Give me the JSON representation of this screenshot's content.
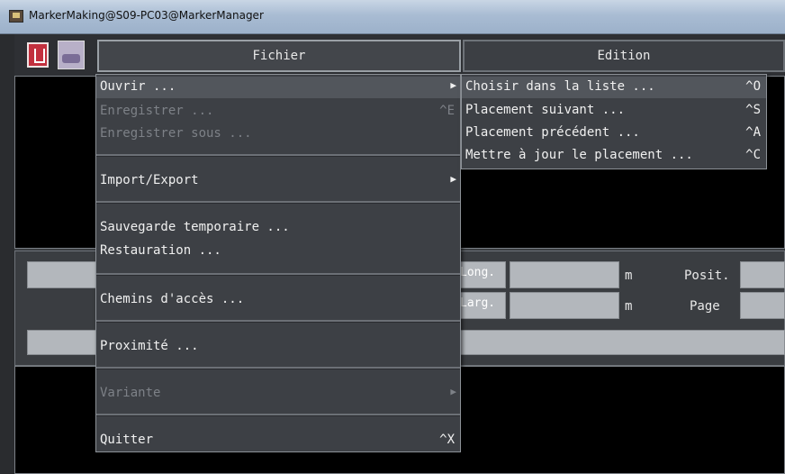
{
  "window": {
    "title": "MarkerMaking@S09-PC03@MarkerManager",
    "icon": "app-icon"
  },
  "toolbar": {
    "icons": [
      "red-document-icon",
      "sink-icon"
    ],
    "menus": [
      {
        "label": "Fichier"
      },
      {
        "label": "Edition"
      }
    ]
  },
  "fields": {
    "long_label": "Long.",
    "larg_label": "Larg.",
    "unit_1": "m",
    "unit_2": "m",
    "posit_label": "Posit.",
    "page_label": "Page"
  },
  "fichier_menu": {
    "items": [
      {
        "label": "Ouvrir ...",
        "shortcut": "",
        "submenu": true,
        "enabled": true,
        "highlighted": true
      },
      {
        "label": "Enregistrer ...",
        "shortcut": "^E",
        "submenu": false,
        "enabled": false
      },
      {
        "label": "Enregistrer sous ...",
        "shortcut": "",
        "submenu": false,
        "enabled": false
      },
      {
        "label": "Import/Export",
        "shortcut": "",
        "submenu": true,
        "enabled": true
      },
      {
        "label": "Sauvegarde temporaire ...",
        "shortcut": "",
        "submenu": false,
        "enabled": true
      },
      {
        "label": "Restauration ...",
        "shortcut": "",
        "submenu": false,
        "enabled": true
      },
      {
        "label": "Chemins d'accès ...",
        "shortcut": "",
        "submenu": false,
        "enabled": true
      },
      {
        "label": "Proximité ...",
        "shortcut": "",
        "submenu": false,
        "enabled": true
      },
      {
        "label": "Variante",
        "shortcut": "",
        "submenu": true,
        "enabled": false
      },
      {
        "label": "Quitter",
        "shortcut": "^X",
        "submenu": false,
        "enabled": true
      }
    ]
  },
  "ouvrir_submenu": {
    "items": [
      {
        "label": "Choisir dans la liste ...",
        "shortcut": "^O",
        "highlighted": true
      },
      {
        "label": "Placement suivant ...",
        "shortcut": "^S"
      },
      {
        "label": "Placement précédent ...",
        "shortcut": "^A"
      },
      {
        "label": "Mettre à jour le placement ...",
        "shortcut": "^C"
      }
    ]
  },
  "icons": {
    "submenu_arrow": "▶"
  }
}
